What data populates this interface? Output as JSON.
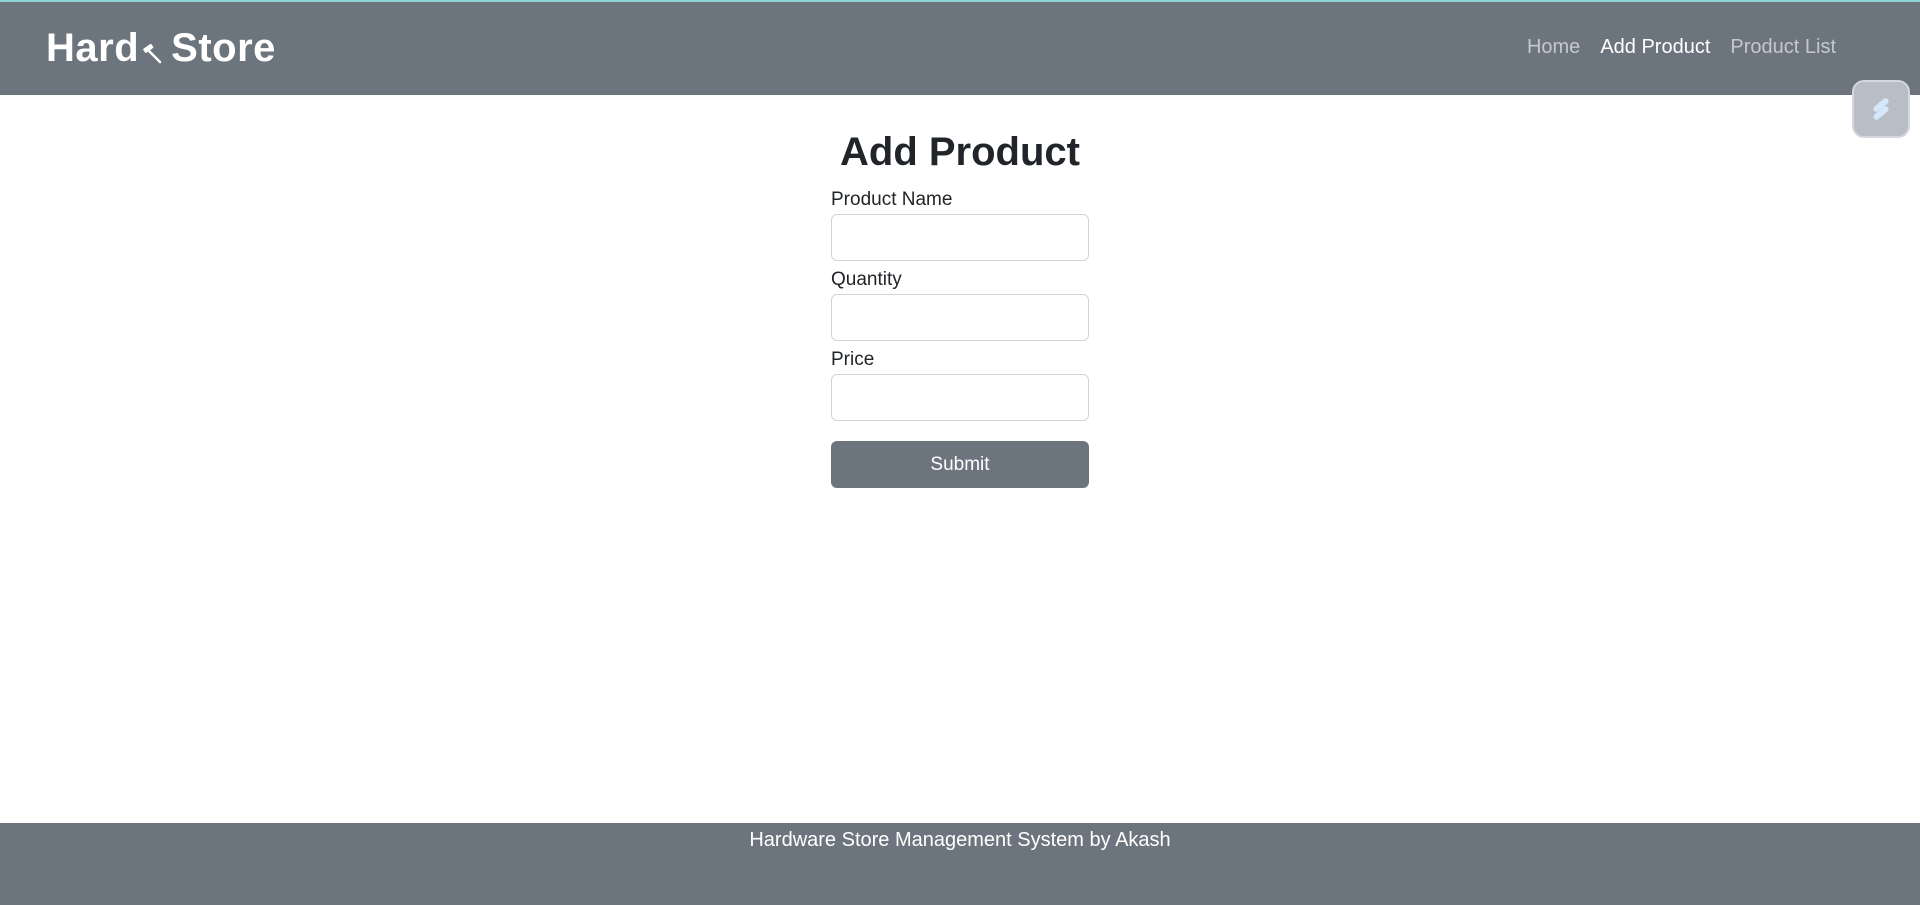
{
  "navbar": {
    "brand_left": "Hard",
    "brand_right": "Store",
    "brand_icon": "hammer-icon",
    "links": [
      {
        "label": "Home",
        "active": false
      },
      {
        "label": "Add Product",
        "active": true
      },
      {
        "label": "Product List",
        "active": false
      }
    ]
  },
  "page": {
    "title": "Add Product"
  },
  "form": {
    "product_name_label": "Product Name",
    "product_name_value": "",
    "quantity_label": "Quantity",
    "quantity_value": "",
    "price_label": "Price",
    "price_value": "",
    "submit_label": "Submit"
  },
  "footer": {
    "text": "Hardware Store Management System by Akash"
  },
  "extension": {
    "icon": "extension-icon"
  },
  "colors": {
    "navbar_bg": "#6c757d",
    "footer_bg": "#6c757d",
    "button_bg": "#6c757d",
    "text": "#212529"
  }
}
